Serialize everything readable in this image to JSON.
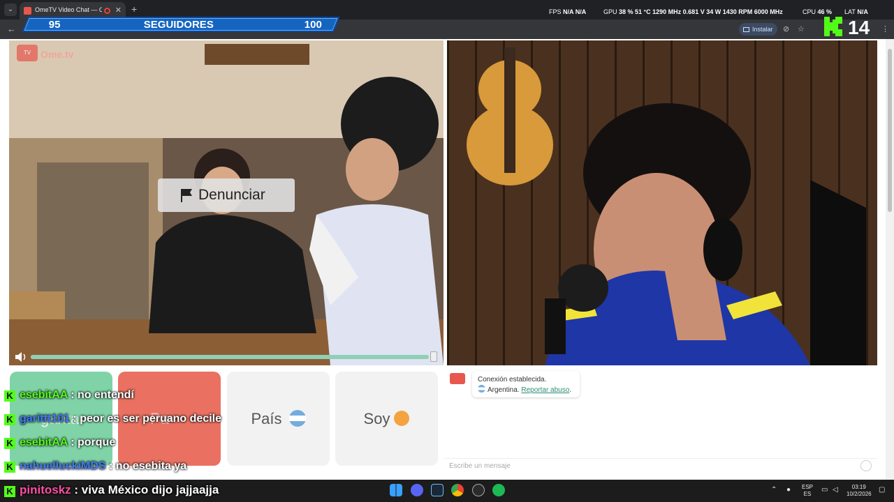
{
  "browser": {
    "tab_title": "OmeTV Video Chat — Ome",
    "install_label": "Instalar"
  },
  "hud": {
    "fps_label": "FPS",
    "fps_value": "N/A",
    "fps_value2": "N/A",
    "gpu_label": "GPU",
    "gpu_stats": "38 %  51 °C  1290 MHz  0.681 V  34 W  1430 RPM  6000 MHz",
    "cpu_label": "CPU",
    "cpu_value": "46 %",
    "lat_label": "LAT",
    "lat_value": "N/A"
  },
  "followers_bar": {
    "current": "95",
    "label": "SEGUIDORES",
    "goal": "100",
    "progress": 0.95
  },
  "kick_count": "14",
  "ome": {
    "logo_text": "Ome.tv",
    "report_label": "Denunciar",
    "volume": 0.98,
    "buttons": {
      "country_label": "País",
      "gender_label": "Soy"
    },
    "chat": {
      "status": "Conexión establecida.",
      "country": "Argentina.",
      "report_abuse": "Reportar abuso",
      "input_placeholder": "Escribe un mensaje"
    }
  },
  "stream_chat": [
    {
      "user": "esebitAA",
      "text": ": no entendí"
    },
    {
      "user": "garittt101",
      "text": ": peor es ser peruano decile"
    },
    {
      "user": "esebitAA",
      "text": ": porque"
    },
    {
      "user": "nahuelluckiMDS",
      "text": ": no esebita ya"
    },
    {
      "user": "pinitoskz",
      "text": ": viva México dijo jajjaajja"
    }
  ],
  "overlapped_labels": {
    "start_fragment": "gantar",
    "stop_fragment": "Pa"
  },
  "taskbar": {
    "lang_top": "ESP",
    "lang_bottom": "ES",
    "time": "03:19",
    "date": "10/2/2026"
  }
}
